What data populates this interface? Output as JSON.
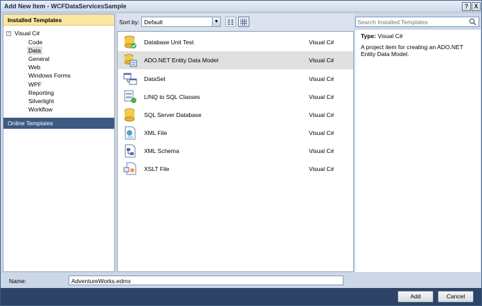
{
  "window": {
    "title": "Add New Item - WCFDataServicesSample",
    "help_glyph": "?",
    "close_glyph": "X"
  },
  "left": {
    "header": "Installed Templates",
    "root": {
      "expander": "−",
      "label": "Visual C#"
    },
    "items": [
      {
        "label": "Code",
        "selected": false
      },
      {
        "label": "Data",
        "selected": true
      },
      {
        "label": "General",
        "selected": false
      },
      {
        "label": "Web",
        "selected": false
      },
      {
        "label": "Windows Forms",
        "selected": false
      },
      {
        "label": "WPF",
        "selected": false
      },
      {
        "label": "Reporting",
        "selected": false
      },
      {
        "label": "Silverlight",
        "selected": false
      },
      {
        "label": "Workflow",
        "selected": false
      }
    ],
    "online": "Online Templates"
  },
  "sort": {
    "label": "Sort by:",
    "value": "Default"
  },
  "search": {
    "placeholder": "Search Installed Templates"
  },
  "templates": [
    {
      "name": "Database Unit Test",
      "lang": "Visual C#",
      "icon": "database-unit-test-icon",
      "selected": false
    },
    {
      "name": "ADO.NET Entity Data Model",
      "lang": "Visual C#",
      "icon": "entity-data-model-icon",
      "selected": true
    },
    {
      "name": "DataSet",
      "lang": "Visual C#",
      "icon": "dataset-icon",
      "selected": false
    },
    {
      "name": "LINQ to SQL Classes",
      "lang": "Visual C#",
      "icon": "linq-to-sql-icon",
      "selected": false
    },
    {
      "name": "SQL Server Database",
      "lang": "Visual C#",
      "icon": "sql-database-icon",
      "selected": false
    },
    {
      "name": "XML File",
      "lang": "Visual C#",
      "icon": "xml-file-icon",
      "selected": false
    },
    {
      "name": "XML Schema",
      "lang": "Visual C#",
      "icon": "xml-schema-icon",
      "selected": false
    },
    {
      "name": "XSLT File",
      "lang": "Visual C#",
      "icon": "xslt-file-icon",
      "selected": false
    }
  ],
  "details": {
    "type_label": "Type:",
    "type_value": "Visual C#",
    "description": "A project item for creating an ADO.NET Entity Data Model."
  },
  "name": {
    "label": "Name:",
    "value": "AdventureWorks.edmx"
  },
  "buttons": {
    "add": "Add",
    "cancel": "Cancel"
  },
  "colors": {
    "accent_header": "#fbe6a2",
    "online_bg": "#3d5a80",
    "button_bar": "#2d4466"
  }
}
